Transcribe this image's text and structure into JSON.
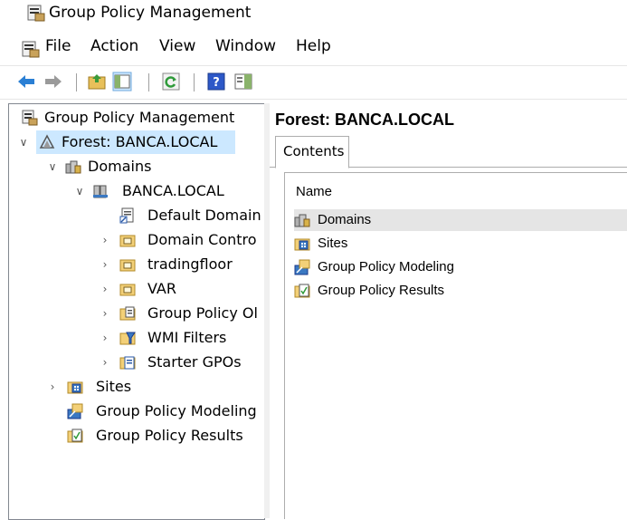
{
  "window": {
    "title": "Group Policy Management"
  },
  "menubar": {
    "items": [
      "File",
      "Action",
      "View",
      "Window",
      "Help"
    ]
  },
  "toolbar": {
    "buttons": [
      "back-icon",
      "forward-icon",
      "up-folder-icon",
      "show-hide-tree-icon",
      "refresh-icon",
      "help-icon",
      "show-hide-action-pane-icon"
    ]
  },
  "tree": {
    "root": "Group Policy Management",
    "forest": "Forest: BANCA.LOCAL",
    "domains": "Domains",
    "domain": "BANCA.LOCAL",
    "domain_children": [
      "Default Domain",
      "Domain Contro",
      "tradingfloor",
      "VAR",
      "Group Policy Ol",
      "WMI Filters",
      "Starter GPOs"
    ],
    "sites": "Sites",
    "modeling": "Group Policy Modeling",
    "results": "Group Policy Results"
  },
  "right": {
    "title": "Forest: BANCA.LOCAL",
    "tab": "Contents",
    "column_name": "Name",
    "items": [
      "Domains",
      "Sites",
      "Group Policy Modeling",
      "Group Policy Results"
    ]
  },
  "colors": {
    "selection": "#cce8ff",
    "hover": "#e5e5e5"
  }
}
